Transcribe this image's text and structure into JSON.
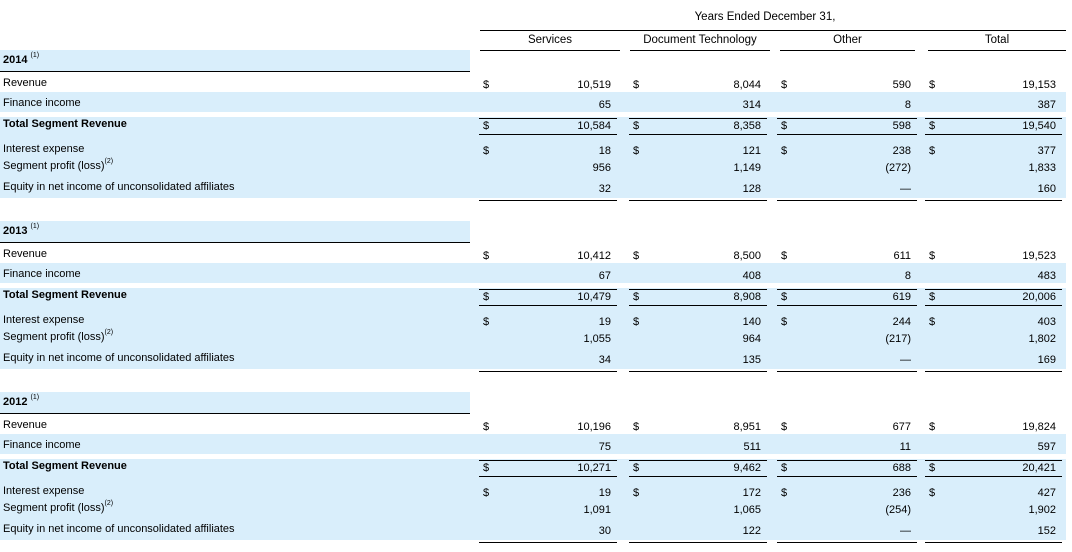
{
  "table": {
    "group_header": "Years Ended December 31,",
    "columns": [
      "Services",
      "Document Technology",
      "Other",
      "Total"
    ],
    "currency_symbol": "$",
    "years": [
      {
        "year": "2014",
        "footnote": "(1)",
        "rows": [
          {
            "label": "Revenue",
            "footnote": "",
            "bold": false,
            "values": [
              "10,519",
              "8,044",
              "590",
              "19,153"
            ],
            "dollar": [
              true,
              true,
              true,
              true
            ]
          },
          {
            "label": "Finance income",
            "footnote": "",
            "bold": false,
            "values": [
              "65",
              "314",
              "8",
              "387"
            ],
            "dollar": [
              false,
              false,
              false,
              false
            ]
          },
          {
            "label": "Total Segment Revenue",
            "footnote": "",
            "bold": true,
            "values": [
              "10,584",
              "8,358",
              "598",
              "19,540"
            ],
            "dollar": [
              true,
              true,
              true,
              true
            ]
          },
          {
            "label": "Interest expense",
            "footnote": "",
            "bold": false,
            "values": [
              "18",
              "121",
              "238",
              "377"
            ],
            "dollar": [
              true,
              true,
              true,
              true
            ]
          },
          {
            "label": "Segment profit (loss)",
            "footnote": "(2)",
            "bold": false,
            "values": [
              "956",
              "1,149",
              "(272)",
              "1,833"
            ],
            "dollar": [
              false,
              false,
              false,
              false
            ]
          },
          {
            "label": "Equity in net income of unconsolidated affiliates",
            "footnote": "",
            "bold": false,
            "values": [
              "32",
              "128",
              "—",
              "160"
            ],
            "dollar": [
              false,
              false,
              false,
              false
            ]
          }
        ]
      },
      {
        "year": "2013",
        "footnote": "(1)",
        "rows": [
          {
            "label": "Revenue",
            "footnote": "",
            "bold": false,
            "values": [
              "10,412",
              "8,500",
              "611",
              "19,523"
            ],
            "dollar": [
              true,
              true,
              true,
              true
            ]
          },
          {
            "label": "Finance income",
            "footnote": "",
            "bold": false,
            "values": [
              "67",
              "408",
              "8",
              "483"
            ],
            "dollar": [
              false,
              false,
              false,
              false
            ]
          },
          {
            "label": "Total Segment Revenue",
            "footnote": "",
            "bold": true,
            "values": [
              "10,479",
              "8,908",
              "619",
              "20,006"
            ],
            "dollar": [
              true,
              true,
              true,
              true
            ]
          },
          {
            "label": "Interest expense",
            "footnote": "",
            "bold": false,
            "values": [
              "19",
              "140",
              "244",
              "403"
            ],
            "dollar": [
              true,
              true,
              true,
              true
            ]
          },
          {
            "label": "Segment profit (loss)",
            "footnote": "(2)",
            "bold": false,
            "values": [
              "1,055",
              "964",
              "(217)",
              "1,802"
            ],
            "dollar": [
              false,
              false,
              false,
              false
            ]
          },
          {
            "label": "Equity in net income of unconsolidated affiliates",
            "footnote": "",
            "bold": false,
            "values": [
              "34",
              "135",
              "—",
              "169"
            ],
            "dollar": [
              false,
              false,
              false,
              false
            ]
          }
        ]
      },
      {
        "year": "2012",
        "footnote": "(1)",
        "rows": [
          {
            "label": "Revenue",
            "footnote": "",
            "bold": false,
            "values": [
              "10,196",
              "8,951",
              "677",
              "19,824"
            ],
            "dollar": [
              true,
              true,
              true,
              true
            ]
          },
          {
            "label": "Finance income",
            "footnote": "",
            "bold": false,
            "values": [
              "75",
              "511",
              "11",
              "597"
            ],
            "dollar": [
              false,
              false,
              false,
              false
            ]
          },
          {
            "label": "Total Segment Revenue",
            "footnote": "",
            "bold": true,
            "values": [
              "10,271",
              "9,462",
              "688",
              "20,421"
            ],
            "dollar": [
              true,
              true,
              true,
              true
            ]
          },
          {
            "label": "Interest expense",
            "footnote": "",
            "bold": false,
            "values": [
              "19",
              "172",
              "236",
              "427"
            ],
            "dollar": [
              true,
              true,
              true,
              true
            ]
          },
          {
            "label": "Segment profit (loss)",
            "footnote": "(2)",
            "bold": false,
            "values": [
              "1,091",
              "1,065",
              "(254)",
              "1,902"
            ],
            "dollar": [
              false,
              false,
              false,
              false
            ]
          },
          {
            "label": "Equity in net income of unconsolidated affiliates",
            "footnote": "",
            "bold": false,
            "values": [
              "30",
              "122",
              "—",
              "152"
            ],
            "dollar": [
              false,
              false,
              false,
              false
            ]
          }
        ]
      }
    ]
  },
  "colors": {
    "band": "#d9eefb",
    "rule": "#000000"
  }
}
